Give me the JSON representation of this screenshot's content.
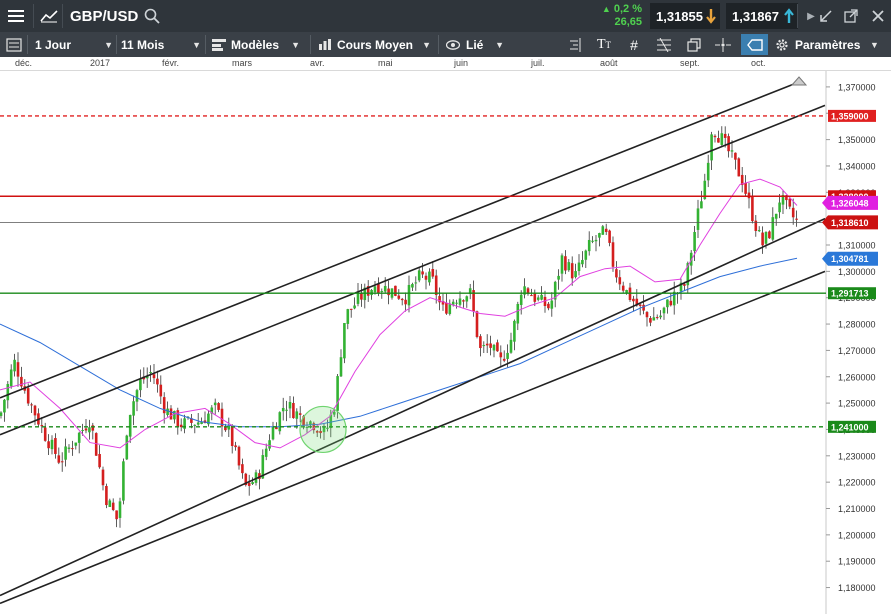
{
  "header": {
    "symbol": "GBP/USD",
    "change_pct": "0,2 %",
    "change_pts": "26,65",
    "sell_price": "1,31855",
    "buy_price": "1,31867"
  },
  "toolbar": {
    "interval": "1 Jour",
    "range": "11 Mois",
    "templates": "Modèles",
    "indicator": "Cours Moyen",
    "link": "Lié",
    "settings": "Paramètres"
  },
  "months": [
    "déc.",
    "2017",
    "févr.",
    "mars",
    "avr.",
    "mai",
    "juin",
    "juil.",
    "août",
    "sept.",
    "oct."
  ],
  "chart_data": {
    "type": "candlestick",
    "instrument": "GBP/USD",
    "ylim": [
      1.173,
      1.373
    ],
    "y_ticks": [
      1.18,
      1.19,
      1.2,
      1.21,
      1.22,
      1.23,
      1.24,
      1.25,
      1.26,
      1.27,
      1.28,
      1.29,
      1.3,
      1.31,
      1.32,
      1.33,
      1.34,
      1.35,
      1.36,
      1.37
    ],
    "y_tick_labels": [
      "1,180000",
      "1,190000",
      "1,200000",
      "1,210000",
      "1,220000",
      "1,230000",
      "1,240000",
      "1,250000",
      "1,260000",
      "1,270000",
      "1,280000",
      "1,290000",
      "1,300000",
      "1,310000",
      "1,320000",
      "1,330000",
      "1,340000",
      "1,350000",
      "1,360000",
      "1,370000"
    ],
    "months": [
      "déc.",
      "2017",
      "févr.",
      "mars",
      "avr.",
      "mai",
      "juin",
      "juil.",
      "août",
      "sept.",
      "oct."
    ],
    "close_path": [
      [
        0,
        1.245
      ],
      [
        14,
        1.266
      ],
      [
        28,
        1.252
      ],
      [
        45,
        1.238
      ],
      [
        60,
        1.228
      ],
      [
        75,
        1.236
      ],
      [
        90,
        1.244
      ],
      [
        105,
        1.215
      ],
      [
        118,
        1.205
      ],
      [
        128,
        1.245
      ],
      [
        140,
        1.258
      ],
      [
        152,
        1.262
      ],
      [
        165,
        1.248
      ],
      [
        180,
        1.242
      ],
      [
        200,
        1.243
      ],
      [
        215,
        1.248
      ],
      [
        230,
        1.238
      ],
      [
        245,
        1.218
      ],
      [
        258,
        1.222
      ],
      [
        270,
        1.238
      ],
      [
        285,
        1.25
      ],
      [
        300,
        1.245
      ],
      [
        315,
        1.242
      ],
      [
        325,
        1.238
      ],
      [
        335,
        1.25
      ],
      [
        345,
        1.283
      ],
      [
        360,
        1.29
      ],
      [
        375,
        1.295
      ],
      [
        390,
        1.293
      ],
      [
        405,
        1.29
      ],
      [
        420,
        1.298
      ],
      [
        432,
        1.297
      ],
      [
        442,
        1.285
      ],
      [
        455,
        1.29
      ],
      [
        470,
        1.292
      ],
      [
        480,
        1.27
      ],
      [
        490,
        1.272
      ],
      [
        500,
        1.265
      ],
      [
        512,
        1.275
      ],
      [
        522,
        1.295
      ],
      [
        535,
        1.29
      ],
      [
        550,
        1.286
      ],
      [
        562,
        1.305
      ],
      [
        575,
        1.298
      ],
      [
        590,
        1.31
      ],
      [
        605,
        1.315
      ],
      [
        615,
        1.3
      ],
      [
        625,
        1.293
      ],
      [
        635,
        1.288
      ],
      [
        648,
        1.282
      ],
      [
        660,
        1.283
      ],
      [
        672,
        1.29
      ],
      [
        685,
        1.295
      ],
      [
        696,
        1.318
      ],
      [
        705,
        1.335
      ],
      [
        712,
        1.355
      ],
      [
        722,
        1.35
      ],
      [
        732,
        1.343
      ],
      [
        742,
        1.335
      ],
      [
        752,
        1.322
      ],
      [
        762,
        1.31
      ],
      [
        770,
        1.315
      ],
      [
        780,
        1.328
      ],
      [
        790,
        1.322
      ],
      [
        797,
        1.3186
      ]
    ],
    "moving_average_fast": [
      [
        0,
        1.255
      ],
      [
        30,
        1.258
      ],
      [
        60,
        1.248
      ],
      [
        90,
        1.235
      ],
      [
        120,
        1.233
      ],
      [
        145,
        1.24
      ],
      [
        175,
        1.246
      ],
      [
        205,
        1.248
      ],
      [
        230,
        1.242
      ],
      [
        255,
        1.235
      ],
      [
        280,
        1.233
      ],
      [
        305,
        1.238
      ],
      [
        330,
        1.245
      ],
      [
        355,
        1.262
      ],
      [
        380,
        1.276
      ],
      [
        405,
        1.285
      ],
      [
        430,
        1.29
      ],
      [
        455,
        1.287
      ],
      [
        480,
        1.284
      ],
      [
        505,
        1.283
      ],
      [
        530,
        1.287
      ],
      [
        555,
        1.29
      ],
      [
        580,
        1.298
      ],
      [
        605,
        1.301
      ],
      [
        630,
        1.302
      ],
      [
        655,
        1.296
      ],
      [
        680,
        1.297
      ],
      [
        700,
        1.31
      ],
      [
        720,
        1.322
      ],
      [
        740,
        1.333
      ],
      [
        760,
        1.335
      ],
      [
        780,
        1.332
      ],
      [
        797,
        1.325
      ]
    ],
    "moving_average_slow": [
      [
        0,
        1.28
      ],
      [
        40,
        1.273
      ],
      [
        80,
        1.264
      ],
      [
        120,
        1.255
      ],
      [
        160,
        1.248
      ],
      [
        200,
        1.243
      ],
      [
        240,
        1.241
      ],
      [
        280,
        1.241
      ],
      [
        320,
        1.242
      ],
      [
        360,
        1.245
      ],
      [
        400,
        1.25
      ],
      [
        440,
        1.255
      ],
      [
        480,
        1.26
      ],
      [
        520,
        1.265
      ],
      [
        560,
        1.272
      ],
      [
        600,
        1.279
      ],
      [
        640,
        1.286
      ],
      [
        680,
        1.292
      ],
      [
        720,
        1.298
      ],
      [
        760,
        1.302
      ],
      [
        797,
        1.305
      ]
    ],
    "horizontal_levels": [
      {
        "value": 1.359,
        "label": "1,359000",
        "color": "#e02020",
        "style": "dashed"
      },
      {
        "value": 1.3285,
        "label": "1,328000",
        "color": "#d01010",
        "style": "solid"
      },
      {
        "value": 1.2917,
        "label": "1,291713",
        "color": "#1a8a1a",
        "style": "solid"
      },
      {
        "value": 1.241,
        "label": "1,241000",
        "color": "#1a8a1a",
        "style": "dashed"
      }
    ],
    "price_tags": [
      {
        "value": 1.326,
        "label": "1,326048",
        "color": "#e020e0",
        "text_color": "#ffffff"
      },
      {
        "value": 1.3186,
        "label": "1,318610",
        "color": "#cc1111",
        "text_color": "#ffffff"
      },
      {
        "value": 1.3048,
        "label": "1,304781",
        "color": "#2a78d8",
        "text_color": "#ffffff"
      }
    ],
    "trend_lines": [
      {
        "from": [
          0,
          1.252
        ],
        "to": [
          800,
          1.372
        ]
      },
      {
        "from": [
          0,
          1.238
        ],
        "to": [
          825,
          1.363
        ]
      },
      {
        "from": [
          0,
          1.177
        ],
        "to": [
          825,
          1.32
        ]
      },
      {
        "from": [
          0,
          1.174
        ],
        "to": [
          825,
          1.3
        ]
      }
    ],
    "highlight_circle": {
      "x": 323,
      "value": 1.24
    }
  }
}
